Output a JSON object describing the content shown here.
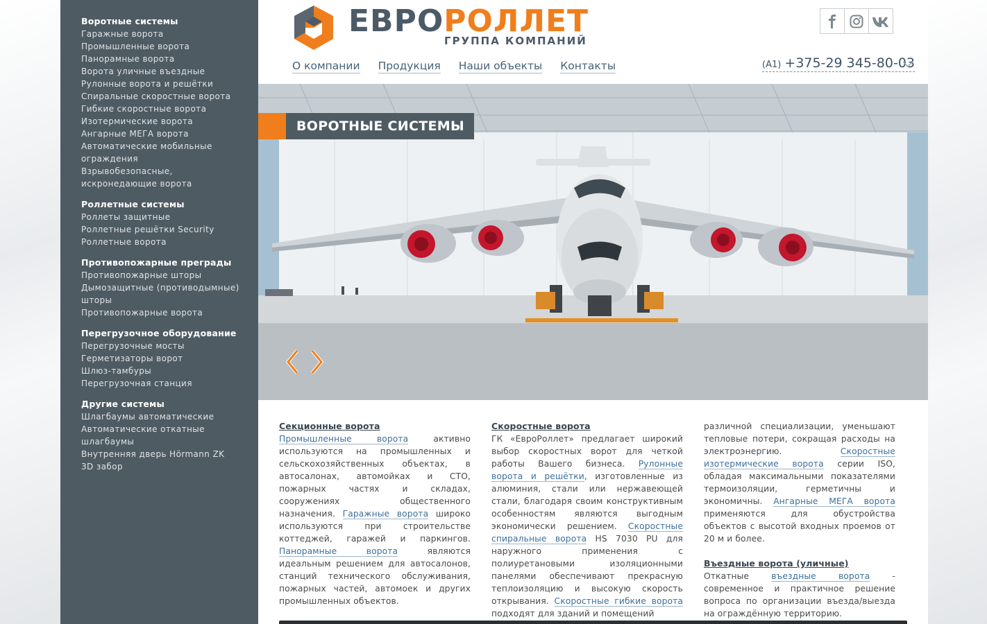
{
  "sidebar": {
    "groups": [
      {
        "title": "Воротные системы",
        "items": [
          "Гаражные ворота",
          "Промышленные ворота",
          "Панорамные ворота",
          "Ворота уличные въездные",
          "Рулонные ворота и решётки",
          "Спиральные скоростные ворота",
          "Гибкие скоростные ворота",
          "Изотермические ворота",
          "Ангарные МЕГА ворота",
          "Автоматические мобильные ограждения",
          "Взрывобезопасные, искронедающие ворота"
        ]
      },
      {
        "title": "Роллетные системы",
        "items": [
          "Роллеты защитные",
          "Роллетные решётки Security",
          "Роллетные ворота"
        ]
      },
      {
        "title": "Противопожарные преграды",
        "items": [
          "Противопожарные шторы",
          "Дымозащитные (противодымные) шторы",
          "Противопожарные ворота"
        ]
      },
      {
        "title": "Перегрузочное оборудование",
        "items": [
          "Перегрузочные мосты",
          "Герметизаторы ворот",
          "Шлюз-тамбуры",
          "Перегрузочная станция"
        ]
      },
      {
        "title": "Другие системы",
        "items": [
          "Шлагбаумы автоматические",
          "Автоматические откатные шлагбаумы",
          "Внутренняя дверь Hörmann ZK",
          "3D забор"
        ]
      }
    ]
  },
  "header": {
    "logo_part1": "ЕВРО",
    "logo_part2": "РОЛЛЕТ",
    "logo_sub": "ГРУППА КОМПАНИЙ",
    "nav": [
      "О компании",
      "Продукция",
      "Наши объекты",
      "Контакты"
    ],
    "phone_operator": "(A1)",
    "phone_number": "+375-29 345-80-03",
    "social": [
      "facebook-icon",
      "instagram-icon",
      "vk-icon"
    ]
  },
  "banner": {
    "label": "ВОРОТНЫЕ СИСТЕМЫ"
  },
  "columns": {
    "c1": {
      "title": "Секционные ворота",
      "l1": "Промышленные ворота",
      "t1": " активно используются на промышленных и сельскохозяйственных объектах, в автосалонах, автомойках и СТО, пожарных частях и складах, сооружениях общественного назначения. ",
      "l2": "Гаражные ворота",
      "t2": " широко используются при строительстве коттеджей, гаражей и паркингов. ",
      "l3": "Панорамные ворота",
      "t3": " являются идеальным решением для автосалонов, станций технического обслуживания, пожарных частей, автомоек и других промышленных объектов."
    },
    "c2": {
      "title": "Скоростные ворота",
      "t0": "ГК «ЕвроРоллет» предлагает широкий выбор скоростных ворот для четкой работы Вашего бизнеса. ",
      "l1": "Рулонные ворота и решётки",
      "t1": ", изготовленные из алюминия, стали или нержавеющей стали, благодаря своим конструктивным особенностям являются выгодным экономически решением. ",
      "l2": "Скоростные спиральные ворота",
      "t2": " HS 7030 PU для наружного применения с полиуретановыми изоляционными панелями обеспечивают прекрасную теплоизоляцию и высокую скорость открывания. ",
      "l3": "Скоростные гибкие ворота",
      "t3": " подходят для зданий и помещений"
    },
    "c3": {
      "t0": "различной специализации, уменьшают тепловые потери, сокращая расходы на электроэнергию. ",
      "l1": "Скоростные изотермические ворота",
      "t1": " серии ISO, обладая максимальными показателями термоизоляции, герметичны и экономичны. ",
      "l2": "Ангарные МЕГА ворота",
      "t2": " применяются для обустройства объектов с высотой входных проемов от 20 м и более.",
      "title2": "Въездные ворота (уличные)",
      "t3": "Откатные ",
      "l3": "въездные ворота",
      "t4": " - современное и практичное решение вопроса по организации въезда/выезда на ограждённую территорию."
    }
  },
  "colors": {
    "sidebar_bg": "#4f5b62",
    "accent_orange": "#f07e1c",
    "logo_gray": "#4c5a68",
    "link_blue": "#3d6f9c"
  }
}
